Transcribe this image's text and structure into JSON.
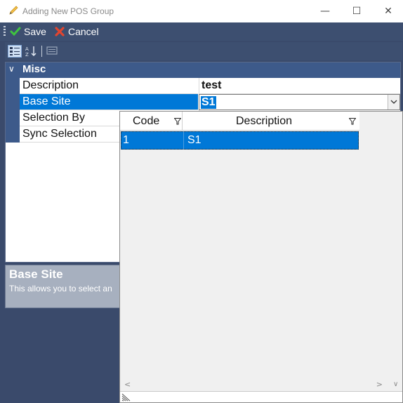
{
  "window": {
    "title": "Adding New POS Group",
    "minimize_glyph": "—",
    "maximize_glyph": "☐",
    "close_glyph": "✕"
  },
  "toolbar": {
    "save_label": "Save",
    "cancel_label": "Cancel",
    "save_icon": "checkmark-icon",
    "cancel_icon": "x-icon"
  },
  "property_grid": {
    "toolbar_buttons": [
      "categorized-view",
      "alphabetical-sort",
      "property-pages"
    ],
    "category": {
      "label": "Misc",
      "expanded": true
    },
    "rows": [
      {
        "name": "Description",
        "value": "test"
      },
      {
        "name": "Base Site",
        "value": "S1",
        "selected": true
      },
      {
        "name": "Selection By",
        "value": ""
      },
      {
        "name": "Sync Selection",
        "value": ""
      }
    ]
  },
  "description_panel": {
    "title": "Base Site",
    "text": "This allows you to select an"
  },
  "dropdown": {
    "columns": [
      "Code",
      "Description"
    ],
    "rows": [
      {
        "code": "1",
        "description": "S1",
        "selected": true
      }
    ]
  },
  "colors": {
    "background": "#3a4a6b",
    "toolbar": "#3d4f70",
    "selection": "#0078d7",
    "category": "#3d5a8a"
  }
}
